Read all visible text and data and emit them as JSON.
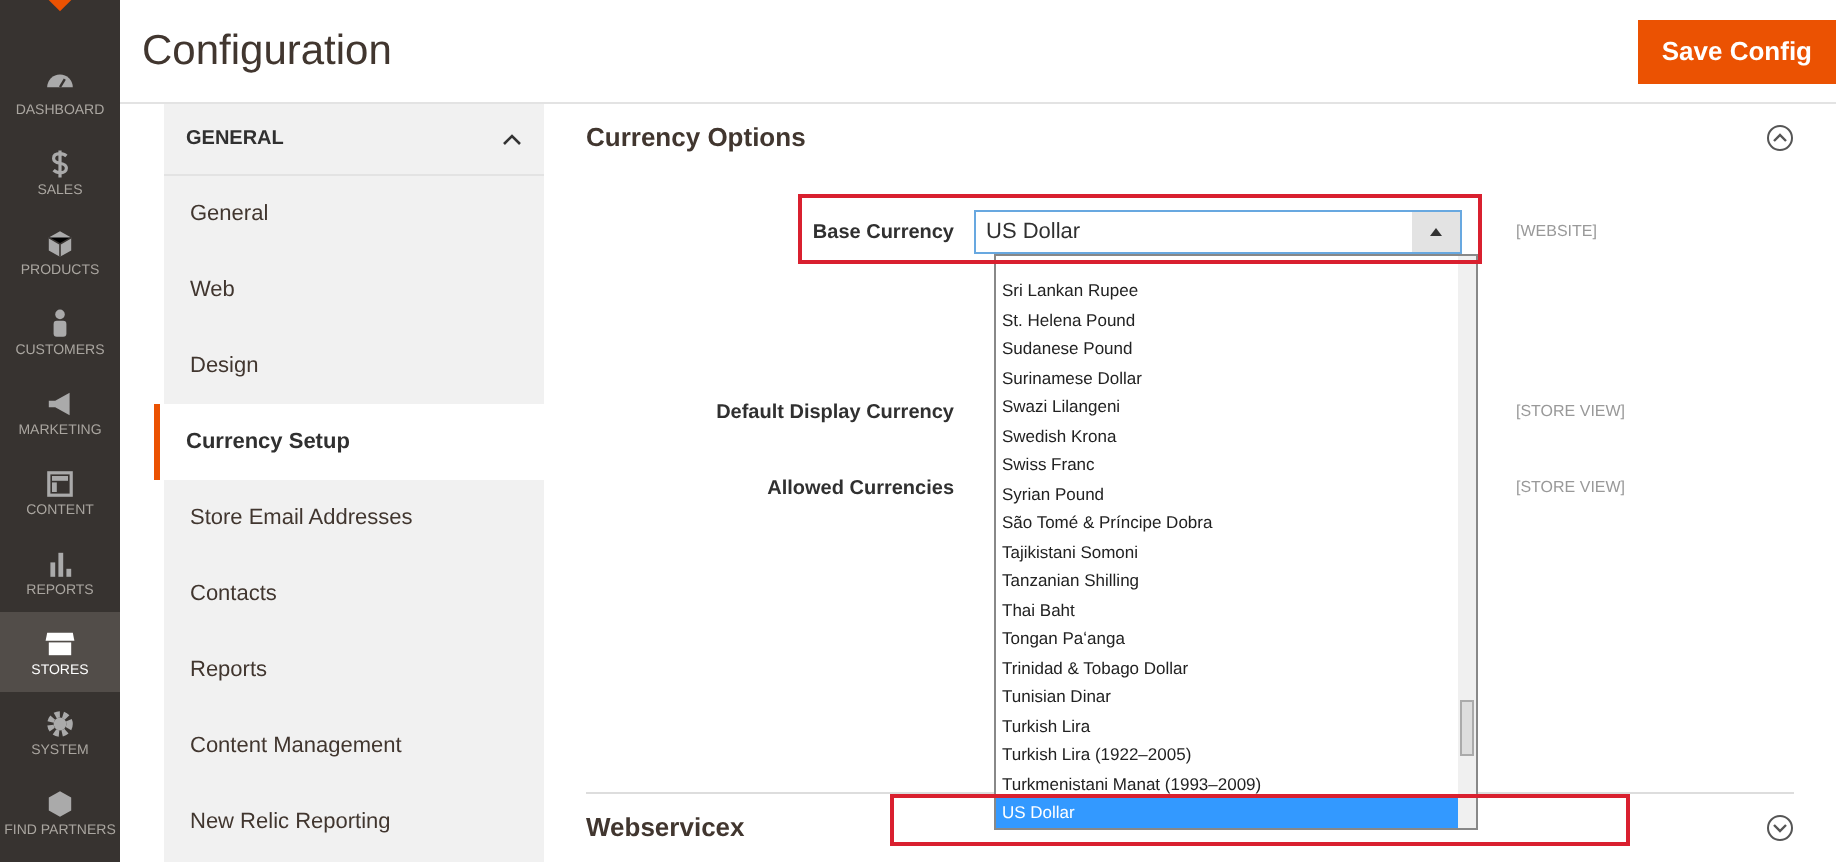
{
  "nav": [
    {
      "label": "DASHBOARD",
      "selected": false
    },
    {
      "label": "SALES",
      "selected": false
    },
    {
      "label": "PRODUCTS",
      "selected": false
    },
    {
      "label": "CUSTOMERS",
      "selected": false
    },
    {
      "label": "MARKETING",
      "selected": false
    },
    {
      "label": "CONTENT",
      "selected": false
    },
    {
      "label": "REPORTS",
      "selected": false
    },
    {
      "label": "STORES",
      "selected": true
    },
    {
      "label": "SYSTEM",
      "selected": false
    },
    {
      "label": "FIND PARTNERS",
      "selected": false
    }
  ],
  "page_title": "Configuration",
  "save_button": "Save Config",
  "config_menu": {
    "group": "GENERAL",
    "expanded": true,
    "items": [
      {
        "label": "General",
        "selected": false
      },
      {
        "label": "Web",
        "selected": false
      },
      {
        "label": "Design",
        "selected": false
      },
      {
        "label": "Currency Setup",
        "selected": true
      },
      {
        "label": "Store Email Addresses",
        "selected": false
      },
      {
        "label": "Contacts",
        "selected": false
      },
      {
        "label": "Reports",
        "selected": false
      },
      {
        "label": "Content Management",
        "selected": false
      },
      {
        "label": "New Relic Reporting",
        "selected": false
      }
    ]
  },
  "section": {
    "title": "Currency Options",
    "expanded": true,
    "fields": [
      {
        "label": "Base Currency",
        "value": "US Dollar",
        "scope": "[WEBSITE]",
        "open": true
      },
      {
        "label": "Default Display Currency",
        "scope": "[STORE VIEW]"
      },
      {
        "label": "Allowed Currencies",
        "scope": "[STORE VIEW]"
      }
    ],
    "dropdown_options": [
      {
        "label": "Sri Lankan Rupee",
        "selected": false
      },
      {
        "label": "St. Helena Pound",
        "selected": false
      },
      {
        "label": "Sudanese Pound",
        "selected": false
      },
      {
        "label": "Surinamese Dollar",
        "selected": false
      },
      {
        "label": "Swazi Lilangeni",
        "selected": false
      },
      {
        "label": "Swedish Krona",
        "selected": false
      },
      {
        "label": "Swiss Franc",
        "selected": false
      },
      {
        "label": "Syrian Pound",
        "selected": false
      },
      {
        "label": "São Tomé & Príncipe Dobra",
        "selected": false
      },
      {
        "label": "Tajikistani Somoni",
        "selected": false
      },
      {
        "label": "Tanzanian Shilling",
        "selected": false
      },
      {
        "label": "Thai Baht",
        "selected": false
      },
      {
        "label": "Tongan Paʻanga",
        "selected": false
      },
      {
        "label": "Trinidad & Tobago Dollar",
        "selected": false
      },
      {
        "label": "Tunisian Dinar",
        "selected": false
      },
      {
        "label": "Turkish Lira",
        "selected": false
      },
      {
        "label": "Turkish Lira (1922–2005)",
        "selected": false
      },
      {
        "label": "Turkmenistani Manat (1993–2009)",
        "selected": false
      },
      {
        "label": "US Dollar",
        "selected": true
      }
    ]
  },
  "next_section": {
    "title": "Webservicex",
    "expanded": false
  }
}
